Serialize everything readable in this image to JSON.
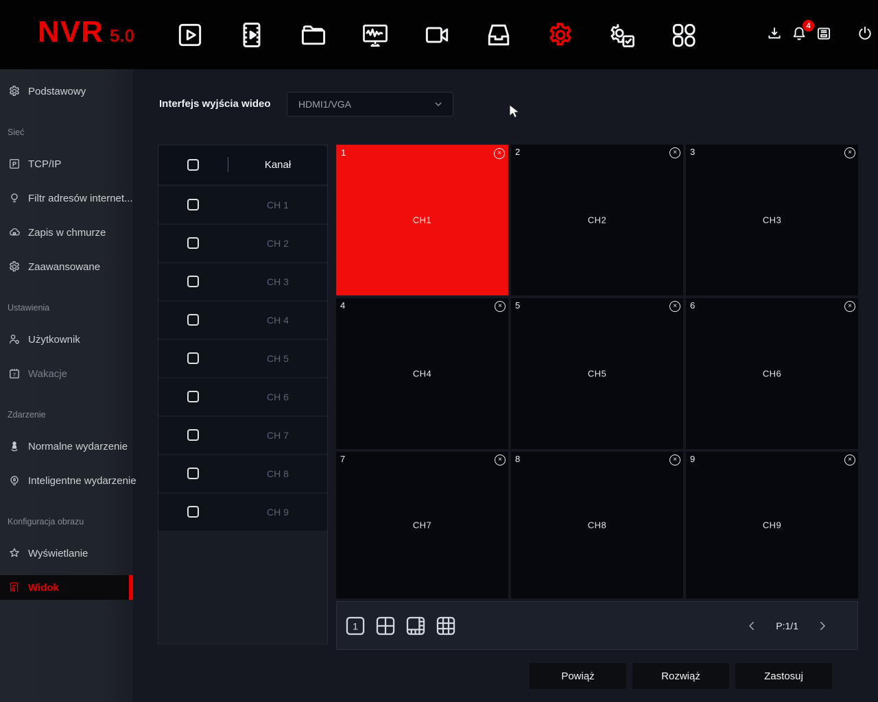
{
  "app": {
    "brand": "NVR",
    "version": "5.0"
  },
  "header": {
    "nav_icons": [
      "live-view",
      "playback",
      "file-management",
      "system-status",
      "camera",
      "storage",
      "settings",
      "maintenance",
      "apps"
    ],
    "right_icons": [
      "export-download",
      "alarm-bell",
      "log-archive",
      "power"
    ],
    "notification_count": "4"
  },
  "sidebar": {
    "items": [
      {
        "label": "Podstawowy",
        "icon": "gear"
      },
      {
        "label": "Sieć",
        "type": "section"
      },
      {
        "label": "TCP/IP",
        "icon": "p-square"
      },
      {
        "label": "Filtr adresów internet...",
        "icon": "bulb"
      },
      {
        "label": "Zapis w chmurze",
        "icon": "cloud"
      },
      {
        "label": "Zaawansowane",
        "icon": "gear"
      },
      {
        "label": "Ustawienia",
        "type": "section"
      },
      {
        "label": "Użytkownik",
        "icon": "user-gear"
      },
      {
        "label": "Wakacje",
        "icon": "calendar"
      },
      {
        "label": "Zdarzenie",
        "type": "section"
      },
      {
        "label": "Normalne wydarzenie",
        "icon": "person"
      },
      {
        "label": "Inteligentne wydarzenie",
        "icon": "smart"
      },
      {
        "label": "Konfiguracja obrazu",
        "type": "section"
      },
      {
        "label": "Wyświetlanie",
        "icon": "star"
      },
      {
        "label": "Widok",
        "icon": "doc-search",
        "active": true
      }
    ]
  },
  "main": {
    "output_label": "Interfejs wyjścia wideo",
    "output_value": "HDMI1/VGA",
    "table": {
      "header": "Kanał",
      "rows": [
        "CH 1",
        "CH 2",
        "CH 3",
        "CH 4",
        "CH 5",
        "CH 6",
        "CH 7",
        "CH 8",
        "CH 9"
      ]
    },
    "grid": {
      "cells": [
        {
          "num": "1",
          "label": "CH1",
          "selected": true
        },
        {
          "num": "2",
          "label": "CH2"
        },
        {
          "num": "3",
          "label": "CH3"
        },
        {
          "num": "4",
          "label": "CH4"
        },
        {
          "num": "5",
          "label": "CH5"
        },
        {
          "num": "6",
          "label": "CH6"
        },
        {
          "num": "7",
          "label": "CH7"
        },
        {
          "num": "8",
          "label": "CH8"
        },
        {
          "num": "9",
          "label": "CH9"
        }
      ]
    },
    "layout_icons": [
      "layout-1",
      "layout-4",
      "layout-1plus",
      "layout-9"
    ],
    "pagination": "P:1/1",
    "buttons": {
      "bind": "Powiąż",
      "unbind": "Rozwiąż",
      "apply": "Zastosuj"
    }
  },
  "colors": {
    "accent": "#e60000",
    "selected_cell": "#f20d0d"
  }
}
